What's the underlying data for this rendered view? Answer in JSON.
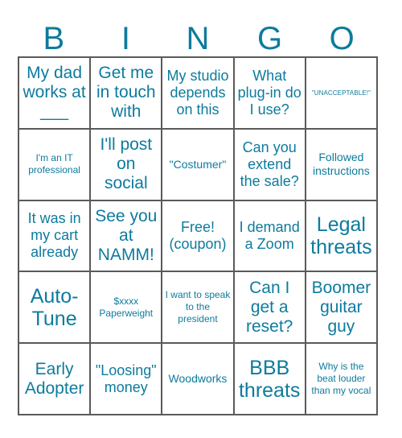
{
  "card": {
    "title": "BINGO",
    "accent_color": "#0d7b9e",
    "border_color": "#5a5a5a",
    "background_color": "#ffffff"
  },
  "header": {
    "letters": [
      "B",
      "I",
      "N",
      "G",
      "O"
    ]
  },
  "grid": {
    "columns": 5,
    "rows": 5,
    "cells": [
      {
        "text": "My dad works at ___",
        "size": "fs-lg"
      },
      {
        "text": "Get me in touch with",
        "size": "fs-lg"
      },
      {
        "text": "My studio depends on this",
        "size": "fs-md"
      },
      {
        "text": "What plug-in do I use?",
        "size": "fs-md"
      },
      {
        "text": "\"UNACCEPTABLE!\"",
        "size": "fs-xxs"
      },
      {
        "text": "I'm an IT professional",
        "size": "fs-xs"
      },
      {
        "text": "I'll post on social",
        "size": "fs-lg"
      },
      {
        "text": "\"Costumer\"",
        "size": "fs-sm"
      },
      {
        "text": "Can you extend the sale?",
        "size": "fs-md"
      },
      {
        "text": "Followed instructions",
        "size": "fs-sm"
      },
      {
        "text": "It was in my cart already",
        "size": "fs-md"
      },
      {
        "text": "See you at NAMM!",
        "size": "fs-lg"
      },
      {
        "text": "Free! (coupon)",
        "size": "fs-md"
      },
      {
        "text": "I demand a Zoom",
        "size": "fs-md"
      },
      {
        "text": "Legal threats",
        "size": "fs-xl"
      },
      {
        "text": "Auto-Tune",
        "size": "fs-xl"
      },
      {
        "text": "$xxxx Paperweight",
        "size": "fs-xs"
      },
      {
        "text": "I want to speak to the president",
        "size": "fs-xs"
      },
      {
        "text": "Can I get a reset?",
        "size": "fs-lg"
      },
      {
        "text": "Boomer guitar guy",
        "size": "fs-lg"
      },
      {
        "text": "Early Adopter",
        "size": "fs-lg"
      },
      {
        "text": "\"Loosing\" money",
        "size": "fs-md"
      },
      {
        "text": "Woodworks",
        "size": "fs-sm"
      },
      {
        "text": "BBB threats",
        "size": "fs-xl"
      },
      {
        "text": "Why is the beat louder than my vocal",
        "size": "fs-xs"
      }
    ]
  }
}
